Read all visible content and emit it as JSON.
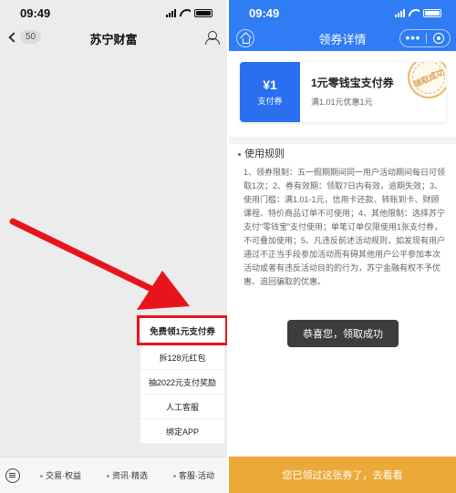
{
  "left": {
    "status": {
      "time": "09:49"
    },
    "nav": {
      "back_badge": "50",
      "title": "苏宁财富"
    },
    "menu": [
      "免费领1元支付券",
      "拆128元红包",
      "抽2022元支付奖励",
      "人工客服",
      "绑定APP"
    ],
    "tabs": [
      "交易·权益",
      "资讯·精选",
      "客服·活动"
    ],
    "colors": {
      "highlight": "#e8141c",
      "arrow": "#e8141c"
    }
  },
  "right": {
    "status": {
      "time": "09:49"
    },
    "nav": {
      "title": "领券详情",
      "more": "•••"
    },
    "coupon": {
      "amount": "¥1",
      "type": "支付券",
      "name": "1元零钱宝支付券",
      "desc": "满1.01元优惠1元",
      "stamp": "领取成功"
    },
    "rules": {
      "title": "使用规则",
      "text": "1、领券限制：五一假期期间同一用户活动期间每日可领取1次；2、券有效期：领取7日内有效，逾期失效；3、使用门槛：满1.01-1元，信用卡还款、转账到卡、财顾课程、特价商品订单不可使用；4、其他限制：选择苏宁支付“零钱宝”支付使用；单笔订单仅限使用1张支付券，不可叠加使用；5、凡违反前述活动规则，如发现有用户通过不正当手段参加活动而有碍其他用户公平参加本次活动或者有违反活动目的的行为，苏宁金融有权不予优惠、追回骗取的优惠。"
    },
    "toast": "恭喜您，领取成功",
    "bottom_button": "您已领过这张券了，去看看",
    "colors": {
      "primary": "#2f7cf4",
      "bottom": "#eba93a"
    }
  }
}
